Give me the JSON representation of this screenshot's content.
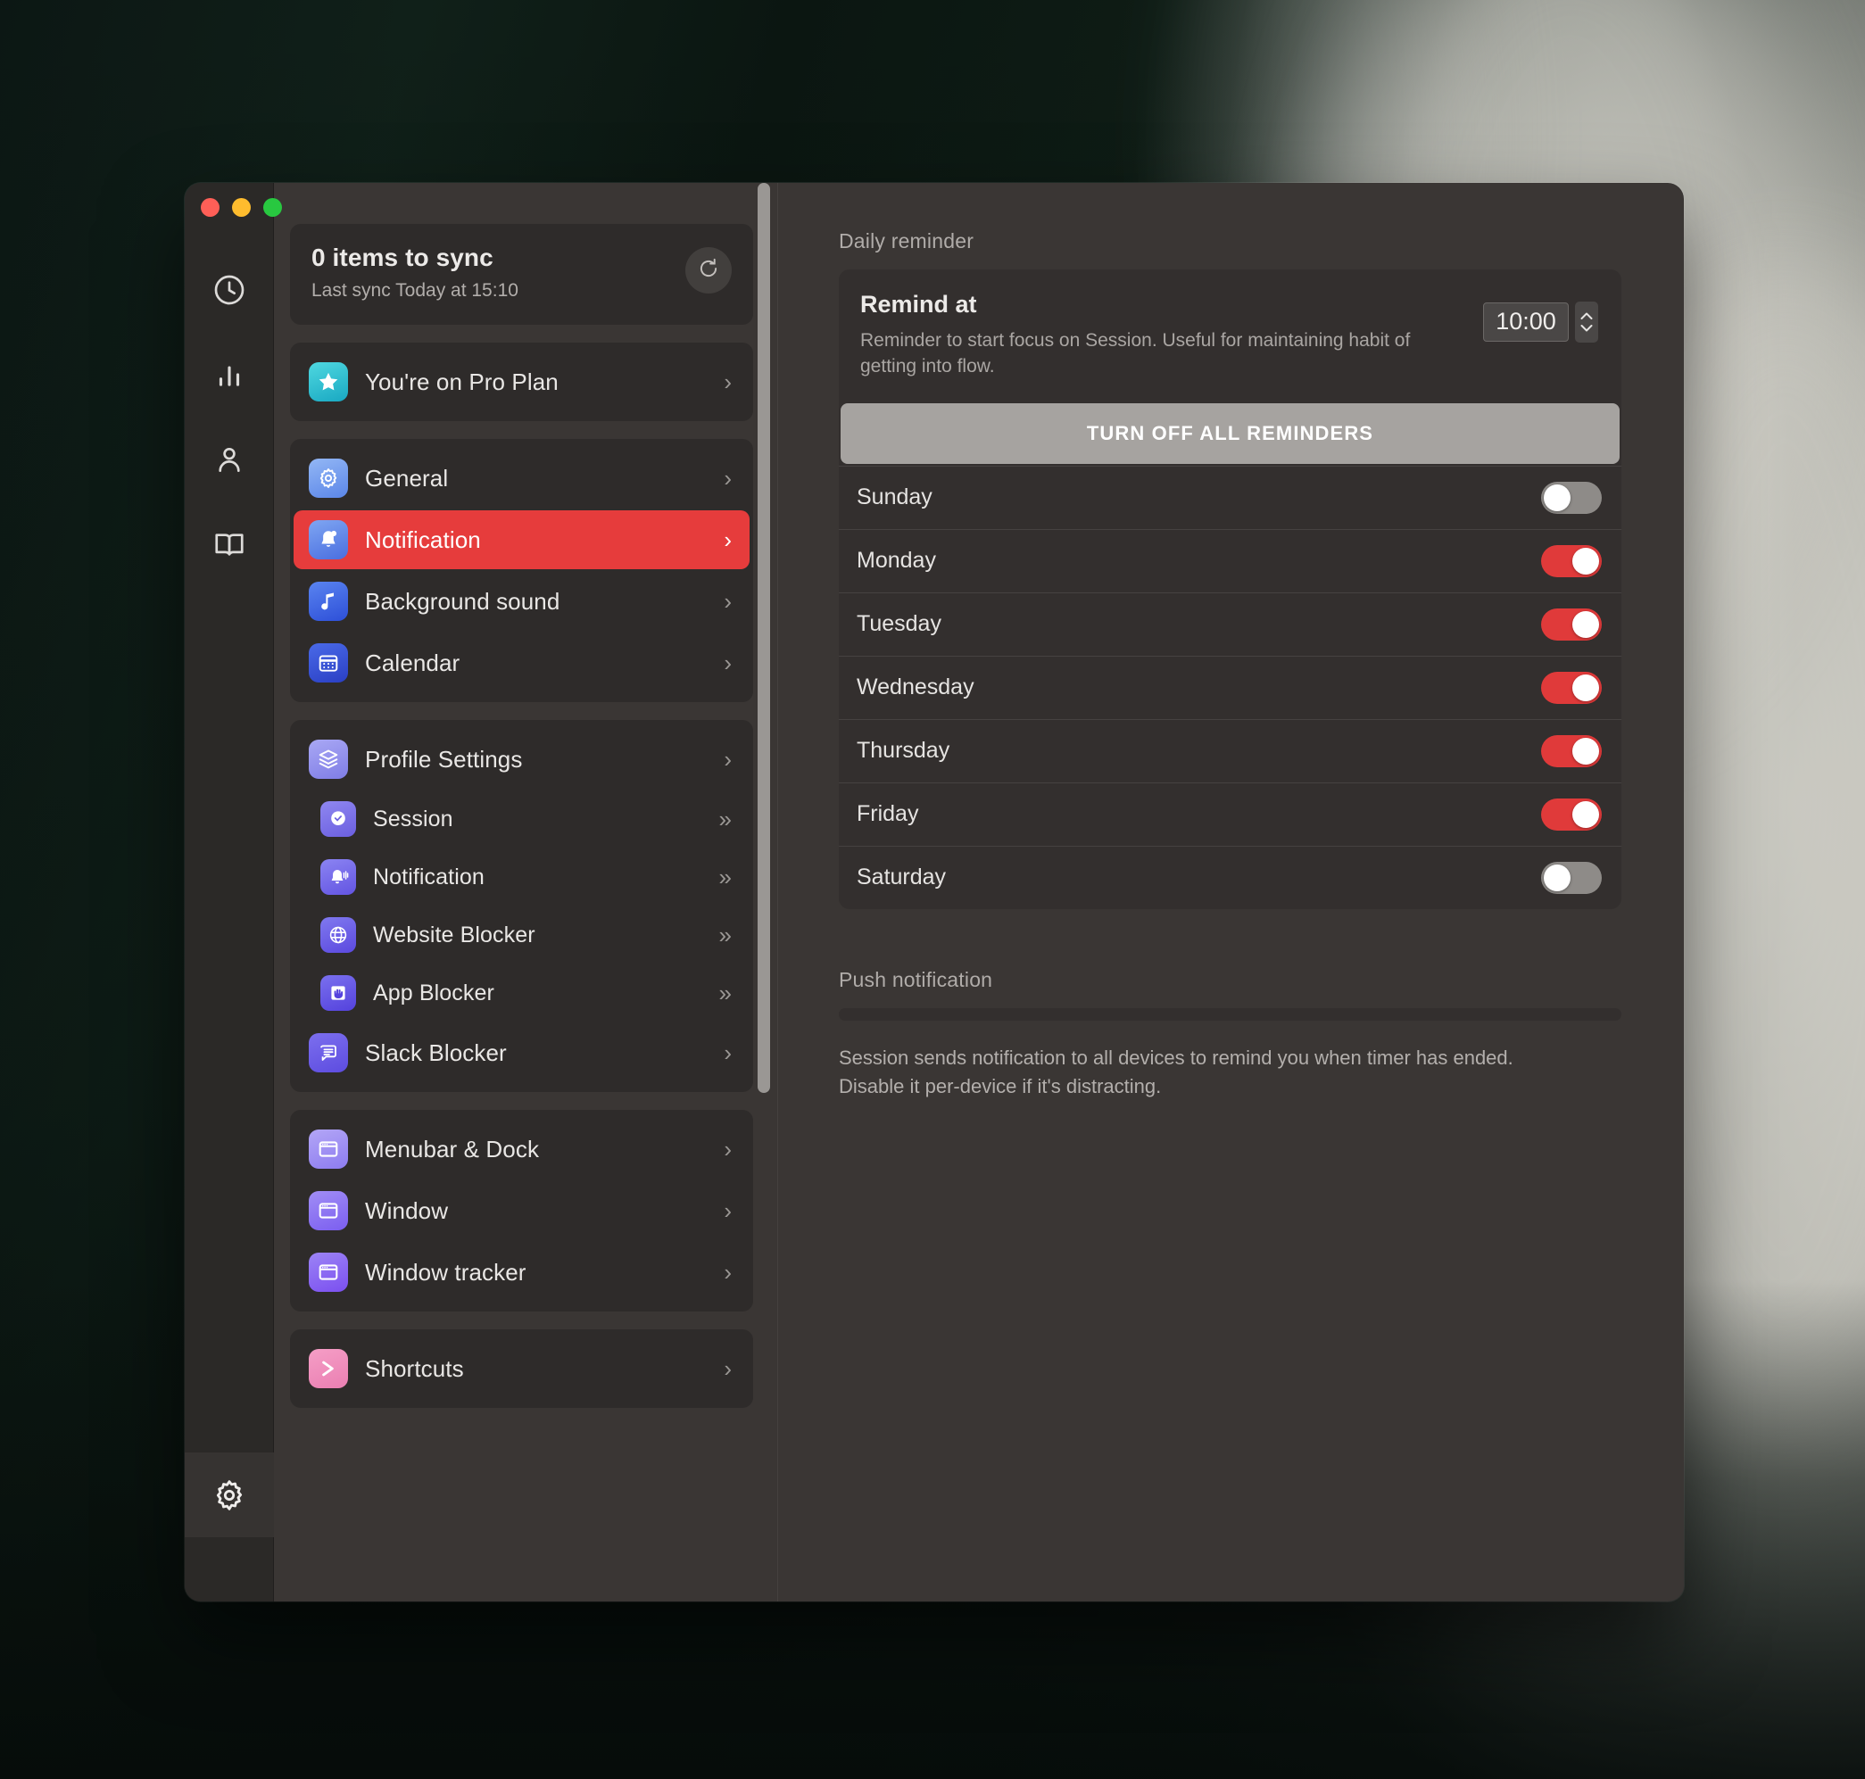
{
  "window": {
    "traffic_lights": [
      "close",
      "minimize",
      "zoom"
    ]
  },
  "rail": {
    "items": [
      {
        "icon": "clock-icon",
        "active": false
      },
      {
        "icon": "bar-chart-icon",
        "active": false
      },
      {
        "icon": "person-icon",
        "active": false
      },
      {
        "icon": "book-icon",
        "active": false
      }
    ],
    "bottom": {
      "icon": "gear-icon",
      "active": true
    }
  },
  "sync": {
    "title": "0 items to sync",
    "subtitle": "Last sync Today at 15:10",
    "refresh_icon": "refresh-icon"
  },
  "settings_groups": [
    {
      "items": [
        {
          "label": "You're on Pro Plan",
          "icon": "star-icon",
          "icon_class": "g-star",
          "chevron": "›",
          "selected": false,
          "sub": false
        }
      ]
    },
    {
      "items": [
        {
          "label": "General",
          "icon": "gear-icon",
          "icon_class": "g-gear",
          "chevron": "›",
          "selected": false,
          "sub": false
        },
        {
          "label": "Notification",
          "icon": "bell-icon",
          "icon_class": "g-bell",
          "chevron": "›",
          "selected": true,
          "sub": false
        },
        {
          "label": "Background sound",
          "icon": "music-note-icon",
          "icon_class": "g-music",
          "chevron": "›",
          "selected": false,
          "sub": false
        },
        {
          "label": "Calendar",
          "icon": "calendar-icon",
          "icon_class": "g-cal",
          "chevron": "›",
          "selected": false,
          "sub": false
        }
      ]
    },
    {
      "items": [
        {
          "label": "Profile Settings",
          "icon": "layers-icon",
          "icon_class": "g-layers",
          "chevron": "›",
          "selected": false,
          "sub": false
        },
        {
          "label": "Session",
          "icon": "session-clock-icon",
          "icon_class": "g-sess",
          "chevron": "»",
          "selected": false,
          "sub": true
        },
        {
          "label": "Notification",
          "icon": "bell-ring-icon",
          "icon_class": "g-bell2",
          "chevron": "»",
          "selected": false,
          "sub": true
        },
        {
          "label": "Website Blocker",
          "icon": "globe-icon",
          "icon_class": "g-globe",
          "chevron": "»",
          "selected": false,
          "sub": true
        },
        {
          "label": "App Blocker",
          "icon": "hand-icon",
          "icon_class": "g-hand",
          "chevron": "»",
          "selected": false,
          "sub": true
        },
        {
          "label": "Slack Blocker",
          "icon": "chat-bubble-icon",
          "icon_class": "g-slack",
          "chevron": "›",
          "selected": false,
          "sub": false
        }
      ]
    },
    {
      "items": [
        {
          "label": "Menubar & Dock",
          "icon": "window-icon",
          "icon_class": "g-win1",
          "chevron": "›",
          "selected": false,
          "sub": false
        },
        {
          "label": "Window",
          "icon": "window-icon",
          "icon_class": "g-win2",
          "chevron": "›",
          "selected": false,
          "sub": false
        },
        {
          "label": "Window tracker",
          "icon": "window-icon",
          "icon_class": "g-win3",
          "chevron": "›",
          "selected": false,
          "sub": false
        }
      ]
    },
    {
      "items": [
        {
          "label": "Shortcuts",
          "icon": "terminal-prompt-icon",
          "icon_class": "g-short",
          "chevron": "›",
          "selected": false,
          "sub": false
        }
      ]
    }
  ],
  "detail": {
    "daily_reminder_label": "Daily reminder",
    "remind_at": {
      "title": "Remind at",
      "description": "Reminder to start focus on Session. Useful for maintaining habit of getting into flow.",
      "time_value": "10:00",
      "stepper_icon": "stepper-arrows-icon"
    },
    "turn_off_label": "TURN OFF ALL REMINDERS",
    "days": [
      {
        "label": "Sunday",
        "on": false
      },
      {
        "label": "Monday",
        "on": true
      },
      {
        "label": "Tuesday",
        "on": true
      },
      {
        "label": "Wednesday",
        "on": true
      },
      {
        "label": "Thursday",
        "on": true
      },
      {
        "label": "Friday",
        "on": true
      },
      {
        "label": "Saturday",
        "on": false
      }
    ],
    "push": {
      "title": "Push notification",
      "description": "Session sends notification to all devices to remind you when timer has ended. Disable it per-device if it's distracting."
    }
  },
  "colors": {
    "accent_red": "#e63c3c",
    "toggle_on": "#e03a3a",
    "toggle_off": "#8e8b88",
    "window_bg": "#3a3634",
    "card_bg": "#2e2b2a",
    "detail_card_bg": "#332f2e",
    "button_gray": "#a6a3a0"
  }
}
